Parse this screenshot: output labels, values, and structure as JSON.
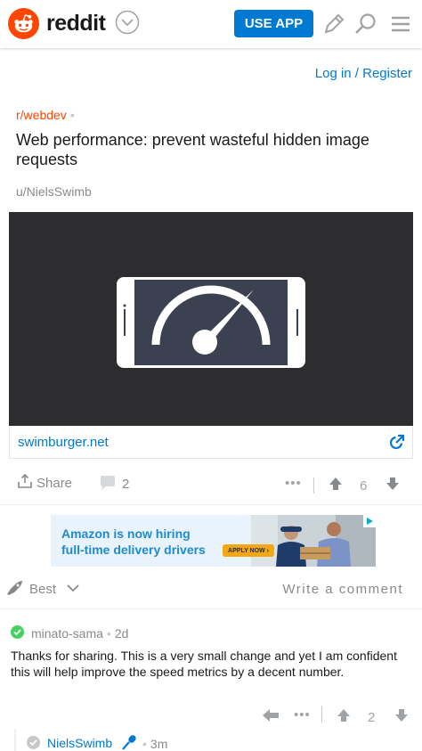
{
  "header": {
    "logo_text": "reddit",
    "use_app_label": "USE APP",
    "icons": [
      "reddit-snoo-icon",
      "chevron-down-icon",
      "pencil-icon",
      "search-icon",
      "menu-icon"
    ]
  },
  "auth": {
    "login_label": "Log in / Register"
  },
  "post": {
    "subreddit": "r/webdev",
    "subreddit_dot": "•",
    "title": "Web performance: prevent wasteful hidden image requests",
    "author": "u/NielsSwimb",
    "link_domain": "swimburger.net",
    "share_label": "Share",
    "comment_count": "2",
    "more_label": "•••",
    "vote_count": "6"
  },
  "ad": {
    "line1": "Amazon is now hiring",
    "line2": "full-time delivery drivers",
    "cta": "APPLY NOW ›"
  },
  "sort": {
    "label": "Best",
    "write_comment": "Write a comment"
  },
  "comments": [
    {
      "user": "minato-sama",
      "age": "2d",
      "sep": "•",
      "body": "Thanks for sharing. This is a very small change and yet I am confident this will help improve the speed metrics by a decent number.",
      "more_label": "•••",
      "votes": "2"
    },
    {
      "user": "NielsSwimb",
      "age": "3m",
      "sep": "•"
    }
  ],
  "colors": {
    "brand_orange": "#ff4500",
    "link_blue": "#0079d3",
    "muted": "#878a8c",
    "badge_green": "#46d160"
  }
}
